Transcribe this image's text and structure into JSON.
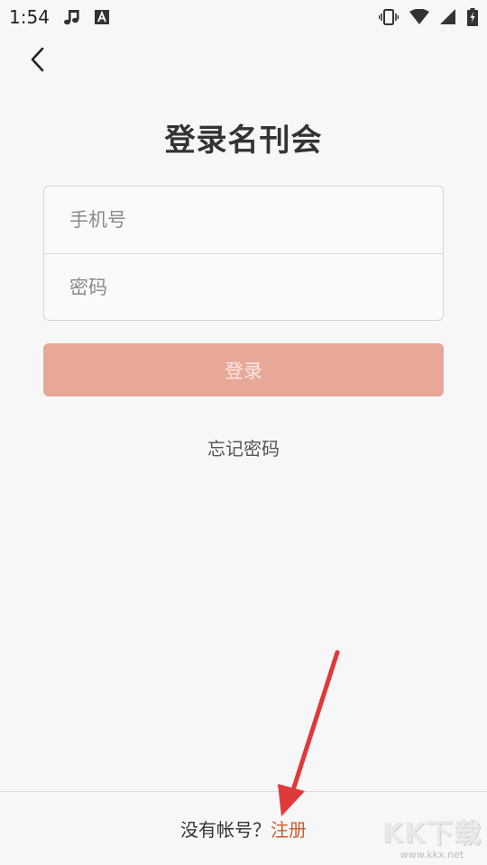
{
  "status_bar": {
    "time": "1:54",
    "icons": [
      "music-note-icon",
      "font-a-icon",
      "vibrate-icon",
      "wifi-icon",
      "signal-icon",
      "battery-charging-icon"
    ]
  },
  "header": {
    "back_icon": "chevron-left-icon",
    "title": "登录名刊会"
  },
  "form": {
    "phone_placeholder": "手机号",
    "phone_value": "",
    "password_placeholder": "密码",
    "password_value": ""
  },
  "login_button": {
    "label": "登录",
    "color": "#e8a898"
  },
  "forgot_password": "忘记密码",
  "footer": {
    "prompt": "没有帐号？",
    "register_label": "注册",
    "register_color": "#d05a2e"
  },
  "watermark": {
    "logo": "KK下载",
    "url": "www.kkx.net"
  },
  "colors": {
    "background": "#f7f7f7",
    "annotation_arrow": "#e0393a"
  }
}
